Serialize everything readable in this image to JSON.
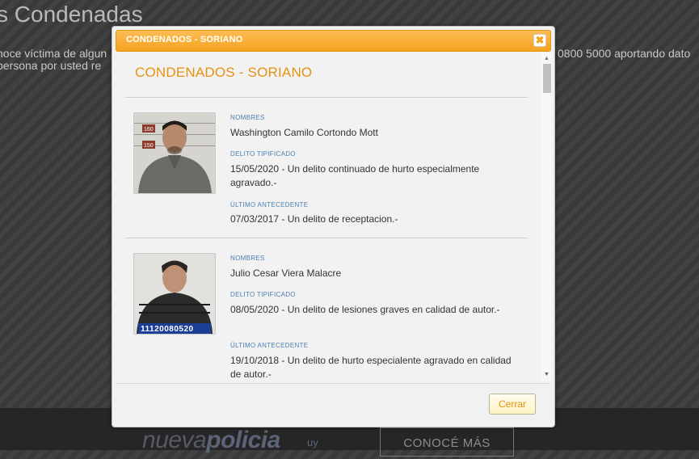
{
  "background": {
    "title": "s Condenadas",
    "line1_left": "noce víctima de algun",
    "line2_left": "persona por usted re",
    "line1_right": "0800 5000 aportando dato",
    "brand_main": "nueva",
    "brand_bold": "policia",
    "brand_suffix": "uy",
    "cta": "CONOCÉ MÁS"
  },
  "dialog": {
    "header_title": "CONDENADOS - SORIANO",
    "close_glyph": "✖",
    "body_title": "CONDENADOS - SORIANO",
    "close_button": "Cerrar",
    "scroll_up": "▲",
    "scroll_down": "▼"
  },
  "labels": {
    "nombres": "NOMBRES",
    "delito": "DELITO TIPIFICADO",
    "antecedente": "ÚLTIMO ANTECEDENTE"
  },
  "records": [
    {
      "name": "Washington Camilo Cortondo Mott",
      "delito": "15/05/2020 - Un delito continuado de hurto especialmente agravado.-",
      "antecedente": "07/03/2017 - Un delito de receptacion.-",
      "photo_marks": [
        "160",
        "150"
      ]
    },
    {
      "name": "Julio Cesar Viera Malacre",
      "delito": "08/05/2020 - Un delito de lesiones graves en calidad de autor.-",
      "antecedente": "19/10/2018 - Un delito de hurto especialente agravado en calidad de autor.-",
      "photo_id": "11120080520"
    }
  ],
  "colors": {
    "accent": "#f5a21f",
    "title_orange": "#e8900f",
    "label_blue": "#4a7fb3"
  }
}
